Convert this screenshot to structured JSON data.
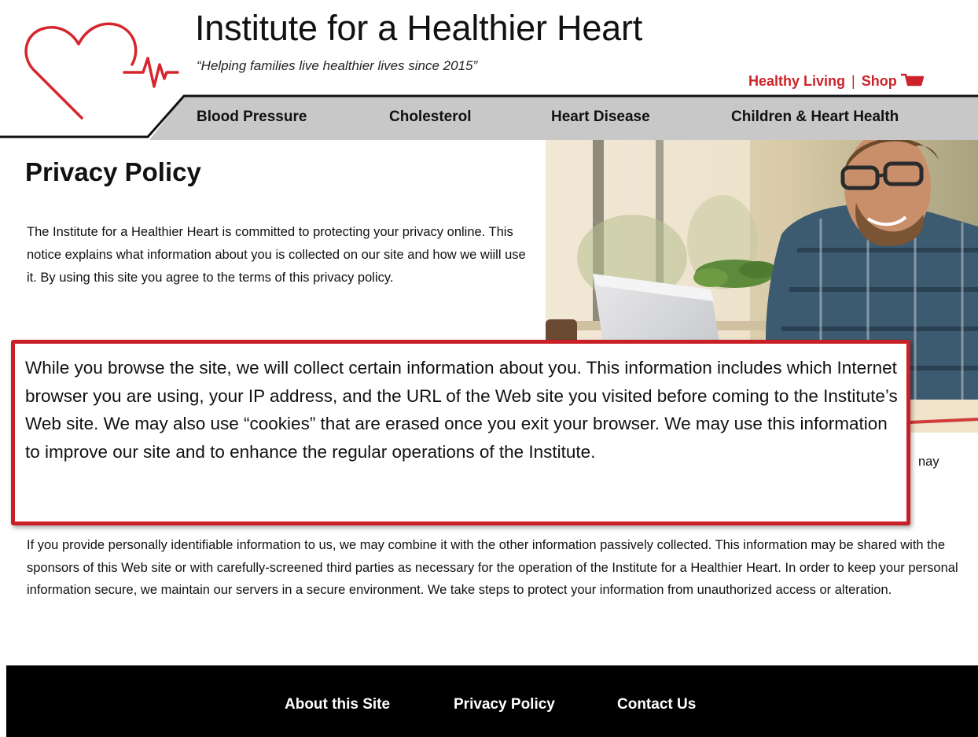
{
  "header": {
    "site_title": "Institute for a Healthier Heart",
    "tagline": "“Helping families live healthier lives since 2015”",
    "top_links": [
      "Healthy Living",
      "Shop"
    ],
    "separator": "|"
  },
  "nav": {
    "items": [
      "Blood Pressure",
      "Cholesterol",
      "Heart Disease",
      "Children & Heart Health"
    ]
  },
  "main": {
    "title": "Privacy Policy",
    "intro": "The Institute for a Healthier Heart is committed to protecting your privacy online. This notice explains what information about you is collected on our site and how we wiill use it. By using this site you agree to the terms of this privacy policy.",
    "callout": "While you browse the site, we will collect certain information about you. This information includes which Internet browser you are using, your IP address, and the URL of the Web site you visited before coming to the Institute’s Web site. We may also use “cookies” that are erased once you exit your browser. We may use this information to improve our site and to enhance the regular operations of the Institute.",
    "partial_hidden_text": "nay",
    "body": "If you provide personally identifiable information to us, we may combine it with the other information passively collected. This information may be shared with the sponsors of this Web site or with carefully-screened third parties as necessary for the operation of the Institute for a Healthier Heart. In order to keep your personal information secure, we maintain our servers in a secure environment.  We take steps to protect your information from unauthorized access or alteration."
  },
  "footer": {
    "links": [
      "About this Site",
      "Privacy Policy",
      "Contact Us"
    ]
  },
  "colors": {
    "brand_red": "#cc2229",
    "nav_gray": "#c8c8c8",
    "footer_black": "#000000",
    "callout_border": "#c92028"
  },
  "icons": [
    "heart-logo-icon",
    "cart-icon"
  ]
}
